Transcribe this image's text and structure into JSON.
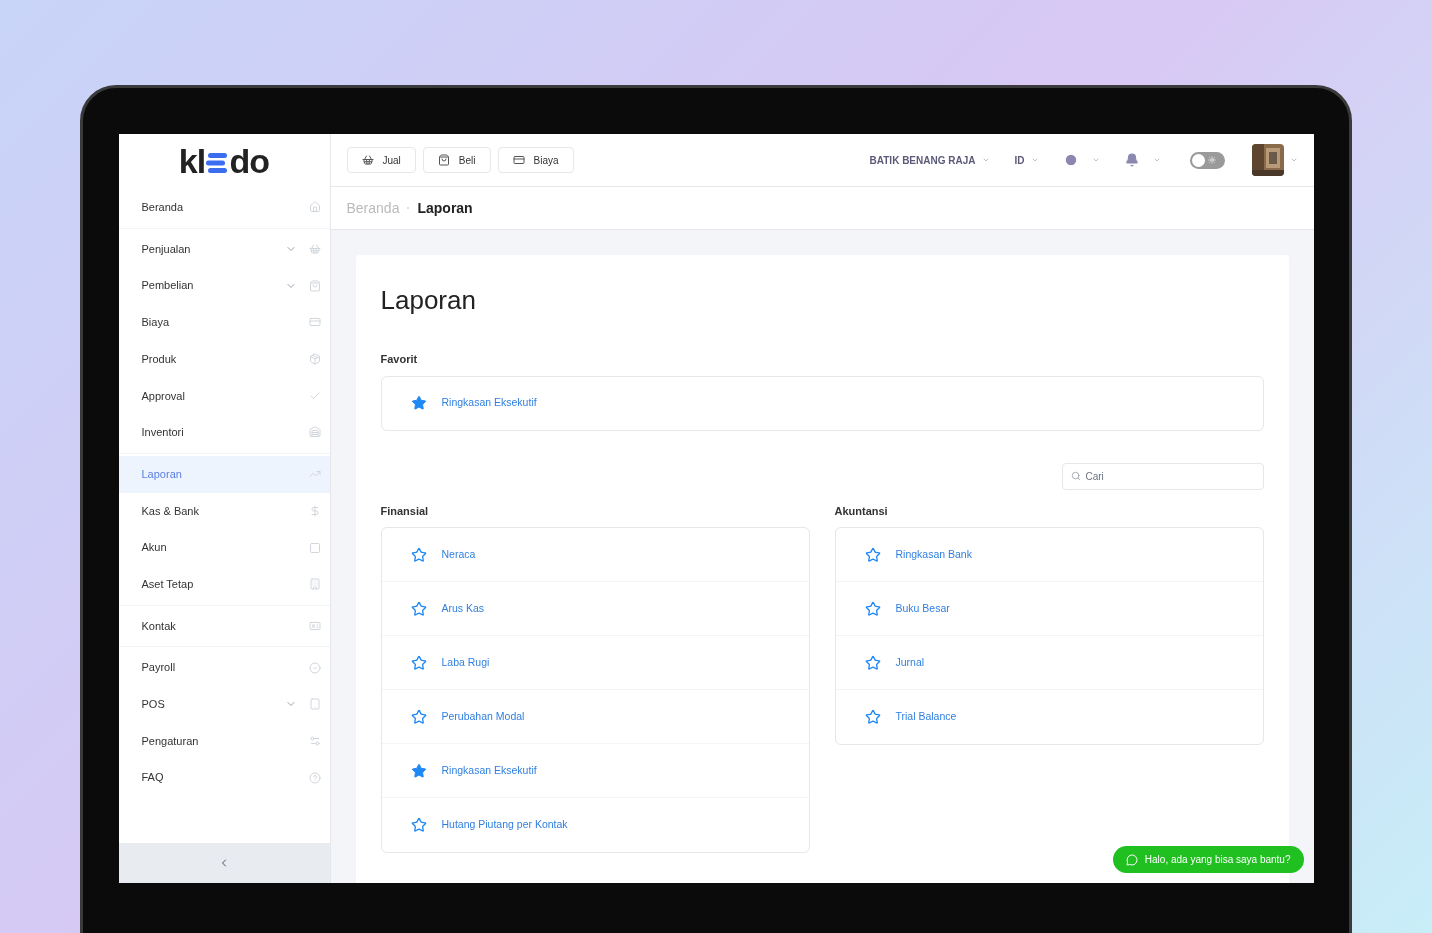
{
  "logo": {
    "left": "kl",
    "right": "do"
  },
  "sidebar": {
    "groups": [
      [
        {
          "label": "Beranda",
          "expandable": false,
          "selected": false
        }
      ],
      [
        {
          "label": "Penjualan",
          "expandable": true,
          "selected": false
        },
        {
          "label": "Pembelian",
          "expandable": true,
          "selected": false
        },
        {
          "label": "Biaya",
          "expandable": false,
          "selected": false
        },
        {
          "label": "Produk",
          "expandable": false,
          "selected": false
        },
        {
          "label": "Approval",
          "expandable": false,
          "selected": false
        },
        {
          "label": "Inventori",
          "expandable": false,
          "selected": false
        }
      ],
      [
        {
          "label": "Laporan",
          "expandable": false,
          "selected": true
        },
        {
          "label": "Kas & Bank",
          "expandable": false,
          "selected": false
        },
        {
          "label": "Akun",
          "expandable": false,
          "selected": false
        },
        {
          "label": "Aset Tetap",
          "expandable": false,
          "selected": false
        }
      ],
      [
        {
          "label": "Kontak",
          "expandable": false,
          "selected": false
        }
      ],
      [
        {
          "label": "Payroll",
          "expandable": false,
          "selected": false
        },
        {
          "label": "POS",
          "expandable": true,
          "selected": false
        },
        {
          "label": "Pengaturan",
          "expandable": false,
          "selected": false
        },
        {
          "label": "FAQ",
          "expandable": false,
          "selected": false
        }
      ]
    ]
  },
  "toolbar": {
    "buttons": [
      "Jual",
      "Beli",
      "Biaya"
    ],
    "company": "BATIK BENANG RAJA",
    "language": "ID",
    "theme_toggle": {
      "on": false
    }
  },
  "breadcrumb": [
    "Beranda",
    "Laporan"
  ],
  "page_title": "Laporan",
  "favorites": {
    "title": "Favorit",
    "items": [
      {
        "label": "Ringkasan Eksekutif",
        "favorite": true
      }
    ]
  },
  "search": {
    "placeholder": "Cari"
  },
  "sections": [
    {
      "title": "Finansial",
      "items": [
        {
          "label": "Neraca",
          "favorite": false
        },
        {
          "label": "Arus Kas",
          "favorite": false
        },
        {
          "label": "Laba Rugi",
          "favorite": false
        },
        {
          "label": "Perubahan Modal",
          "favorite": false
        },
        {
          "label": "Ringkasan Eksekutif",
          "favorite": true
        },
        {
          "label": "Hutang Piutang per Kontak",
          "favorite": false
        }
      ]
    },
    {
      "title": "Akuntansi",
      "items": [
        {
          "label": "Ringkasan Bank",
          "favorite": false
        },
        {
          "label": "Buku Besar",
          "favorite": false
        },
        {
          "label": "Jurnal",
          "favorite": false
        },
        {
          "label": "Trial Balance",
          "favorite": false
        }
      ]
    }
  ],
  "chat_button": "Halo, ada yang bisa saya bantu?"
}
